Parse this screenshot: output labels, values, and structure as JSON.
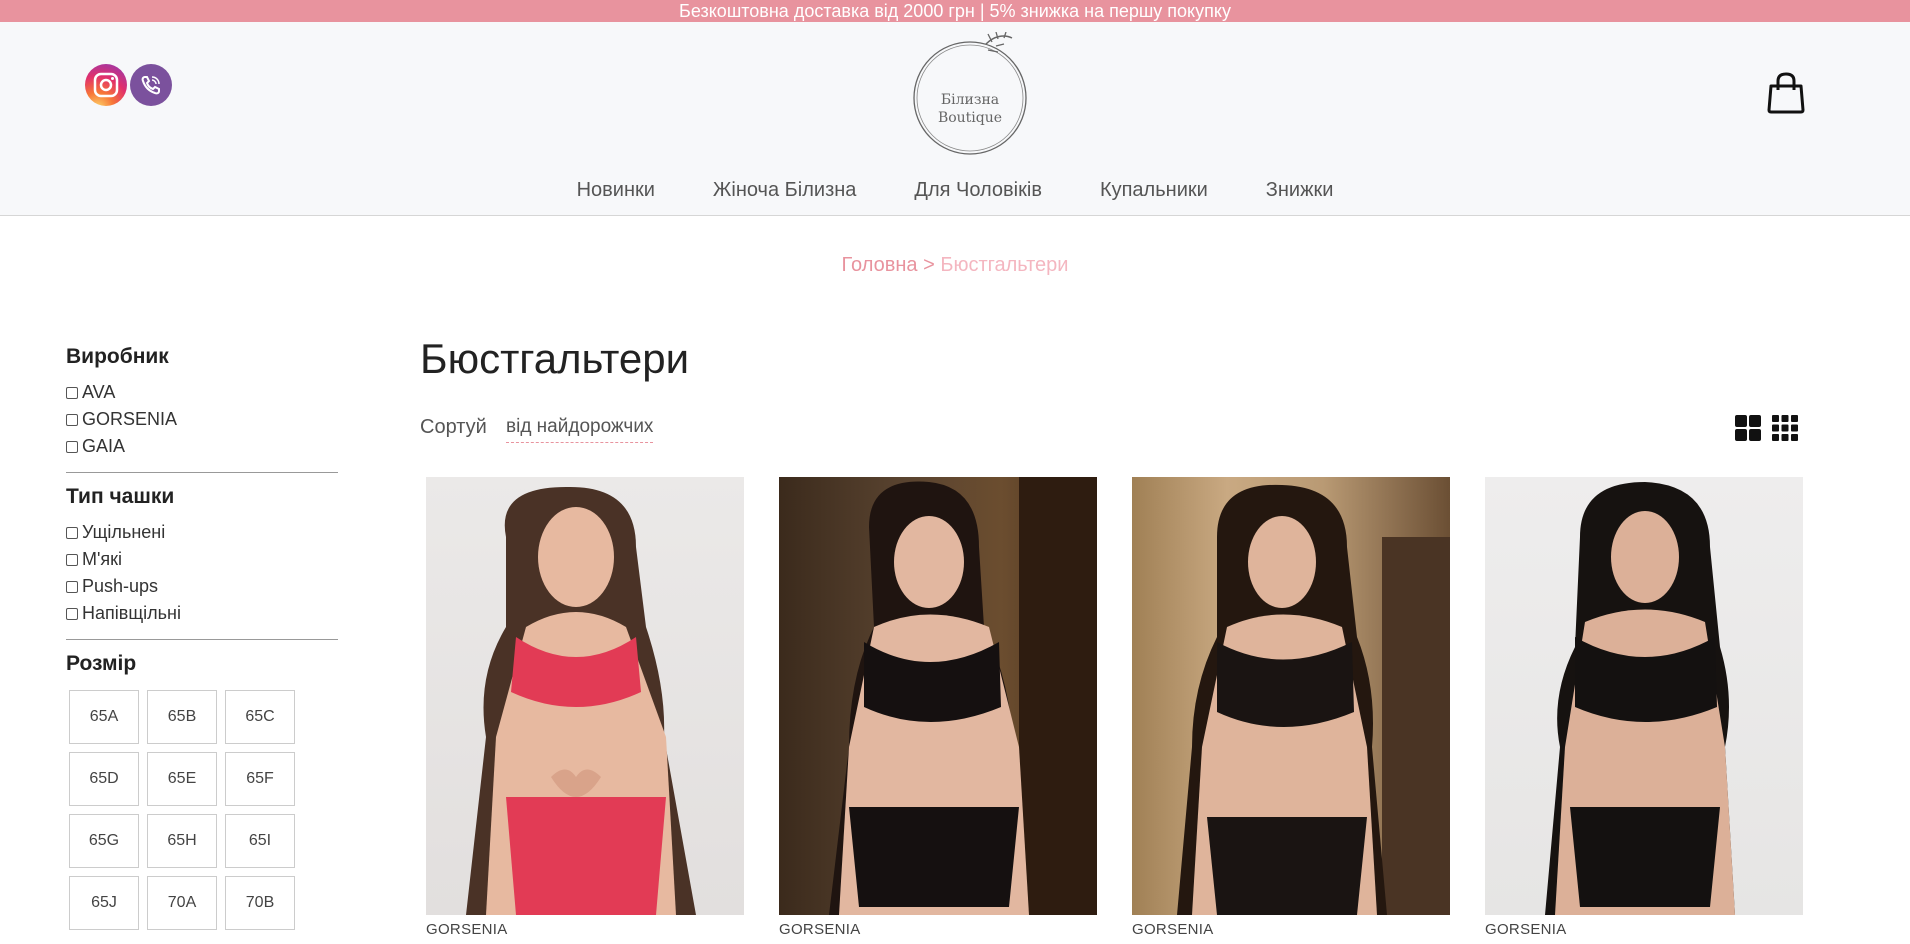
{
  "promo": {
    "text": "Безкоштовна доставка від 2000 грн | 5% знижка на першу покупку"
  },
  "header": {
    "logo_line1": "Білизна",
    "logo_line2": "Boutique",
    "social_icons": [
      "instagram-icon",
      "viber-icon"
    ],
    "cart_icon": "shopping-bag-icon"
  },
  "nav": {
    "items": [
      {
        "label": "Новинки"
      },
      {
        "label": "Жіноча Білизна"
      },
      {
        "label": "Для Чоловіків"
      },
      {
        "label": "Купальники"
      },
      {
        "label": "Знижки"
      }
    ]
  },
  "breadcrumb": {
    "home": "Головна",
    "separator": ">",
    "current": "Бюстгальтери"
  },
  "filters": {
    "manufacturer": {
      "title": "Виробник",
      "options": [
        "AVA",
        "GORSENIA",
        "GAIA"
      ]
    },
    "cup_type": {
      "title": "Тип чашки",
      "options": [
        "Ущільнені",
        "М'які",
        "Push-ups",
        "Напівщільні"
      ]
    },
    "size": {
      "title": "Розмір",
      "options": [
        "65A",
        "65B",
        "65C",
        "65D",
        "65E",
        "65F",
        "65G",
        "65H",
        "65I",
        "65J",
        "70A",
        "70B"
      ]
    }
  },
  "main": {
    "title": "Бюстгальтери",
    "sort_label": "Сортуй",
    "sort_value": "від найдорожчих"
  },
  "products": [
    {
      "brand": "GORSENIA",
      "color": "red"
    },
    {
      "brand": "GORSENIA",
      "color": "black"
    },
    {
      "brand": "GORSENIA",
      "color": "black"
    },
    {
      "brand": "GORSENIA",
      "color": "black"
    }
  ],
  "colors": {
    "accent": "#e8939e",
    "accent_light": "#f4b6c0",
    "header_bg": "#f7f8fa"
  }
}
